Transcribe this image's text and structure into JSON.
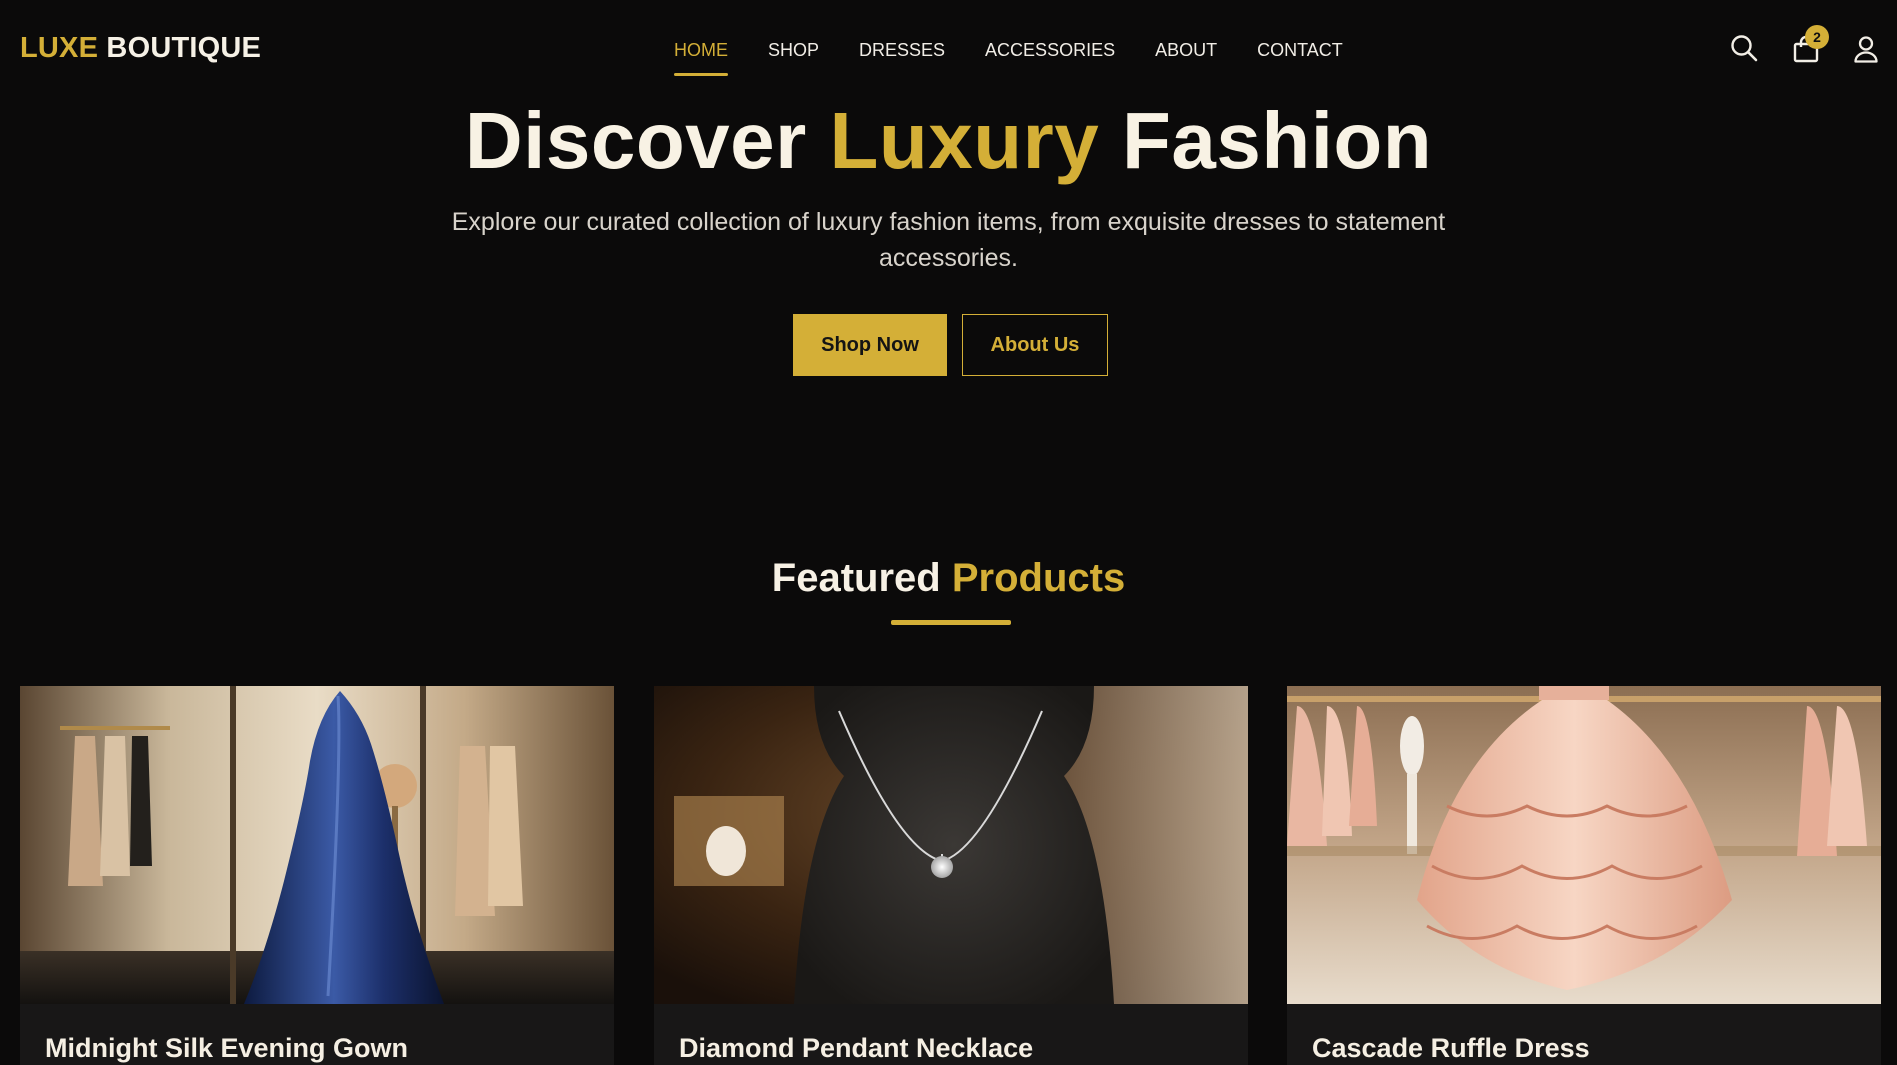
{
  "brand": {
    "accent": "LUXE",
    "rest": "BOUTIQUE",
    "accent_color": "#d4af37"
  },
  "nav": {
    "items": [
      {
        "label": "HOME",
        "active": true
      },
      {
        "label": "SHOP",
        "active": false
      },
      {
        "label": "DRESSES",
        "active": false
      },
      {
        "label": "ACCESSORIES",
        "active": false
      },
      {
        "label": "ABOUT",
        "active": false
      },
      {
        "label": "CONTACT",
        "active": false
      }
    ]
  },
  "header_icons": {
    "search": "search-icon",
    "cart": "shopping-bag-icon",
    "cart_count": "2",
    "account": "user-icon"
  },
  "hero": {
    "title_part1": "Discover ",
    "title_highlight": "Luxury",
    "title_part2": " Fashion",
    "subtitle": "Explore our curated collection of luxury fashion items, from exquisite dresses to statement accessories.",
    "primary_button": "Shop Now",
    "secondary_button": "About Us"
  },
  "featured": {
    "title_part1": "Featured ",
    "title_highlight": "Products",
    "products": [
      {
        "name": "Midnight Silk Evening Gown",
        "image": "navy-evening-gown-in-boutique"
      },
      {
        "name": "Diamond Pendant Necklace",
        "image": "diamond-pendant-on-black-bust"
      },
      {
        "name": "Cascade Ruffle Dress",
        "image": "blush-ruffle-dress-in-boutique"
      }
    ]
  },
  "colors": {
    "background": "#0b0a0a",
    "gold": "#d4af37",
    "card": "#181717",
    "text": "#f4efe6"
  }
}
